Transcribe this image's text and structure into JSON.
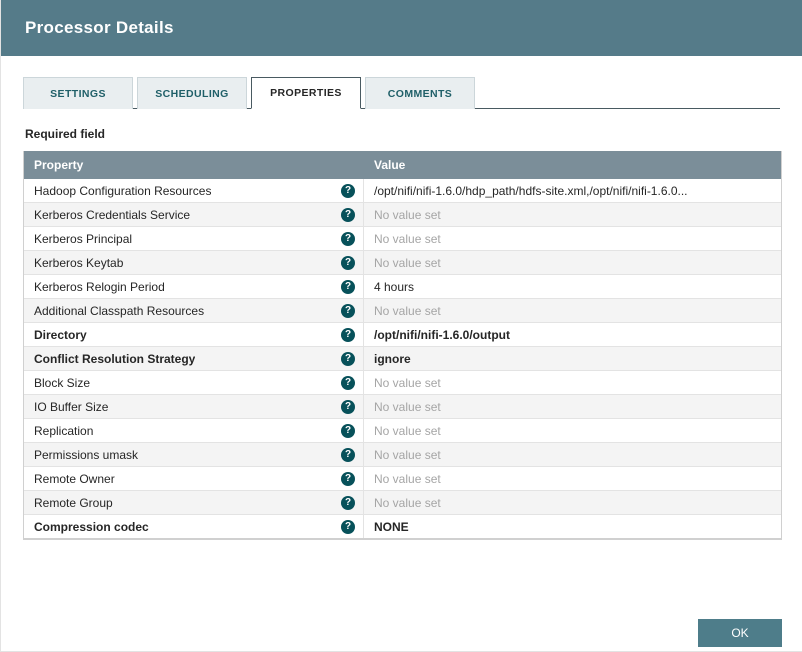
{
  "dialog": {
    "title": "Processor Details"
  },
  "tabs": [
    {
      "label": "SETTINGS",
      "active": false
    },
    {
      "label": "SCHEDULING",
      "active": false
    },
    {
      "label": "PROPERTIES",
      "active": true
    },
    {
      "label": "COMMENTS",
      "active": false
    }
  ],
  "required_field_label": "Required field",
  "help_icon_glyph": "?",
  "table": {
    "headers": {
      "property": "Property",
      "value": "Value"
    },
    "rows": [
      {
        "property": "Hadoop Configuration Resources",
        "value": "/opt/nifi/nifi-1.6.0/hdp_path/hdfs-site.xml,/opt/nifi/nifi-1.6.0...",
        "bold": false,
        "no_value": false
      },
      {
        "property": "Kerberos Credentials Service",
        "value": "No value set",
        "bold": false,
        "no_value": true
      },
      {
        "property": "Kerberos Principal",
        "value": "No value set",
        "bold": false,
        "no_value": true
      },
      {
        "property": "Kerberos Keytab",
        "value": "No value set",
        "bold": false,
        "no_value": true
      },
      {
        "property": "Kerberos Relogin Period",
        "value": "4 hours",
        "bold": false,
        "no_value": false
      },
      {
        "property": "Additional Classpath Resources",
        "value": "No value set",
        "bold": false,
        "no_value": true
      },
      {
        "property": "Directory",
        "value": "/opt/nifi/nifi-1.6.0/output",
        "bold": true,
        "no_value": false
      },
      {
        "property": "Conflict Resolution Strategy",
        "value": "ignore",
        "bold": true,
        "no_value": false
      },
      {
        "property": "Block Size",
        "value": "No value set",
        "bold": false,
        "no_value": true
      },
      {
        "property": "IO Buffer Size",
        "value": "No value set",
        "bold": false,
        "no_value": true
      },
      {
        "property": "Replication",
        "value": "No value set",
        "bold": false,
        "no_value": true
      },
      {
        "property": "Permissions umask",
        "value": "No value set",
        "bold": false,
        "no_value": true
      },
      {
        "property": "Remote Owner",
        "value": "No value set",
        "bold": false,
        "no_value": true
      },
      {
        "property": "Remote Group",
        "value": "No value set",
        "bold": false,
        "no_value": true
      },
      {
        "property": "Compression codec",
        "value": "NONE",
        "bold": true,
        "no_value": false
      }
    ]
  },
  "ok_button_label": "OK",
  "colors": {
    "header_bg": "#557b89",
    "table_header_bg": "#7b8e99",
    "help_icon_bg": "#07515a",
    "ok_button_bg": "#4e7d8a",
    "row_alt_bg": "#f4f4f4",
    "no_value_text": "#a5a5a5"
  }
}
